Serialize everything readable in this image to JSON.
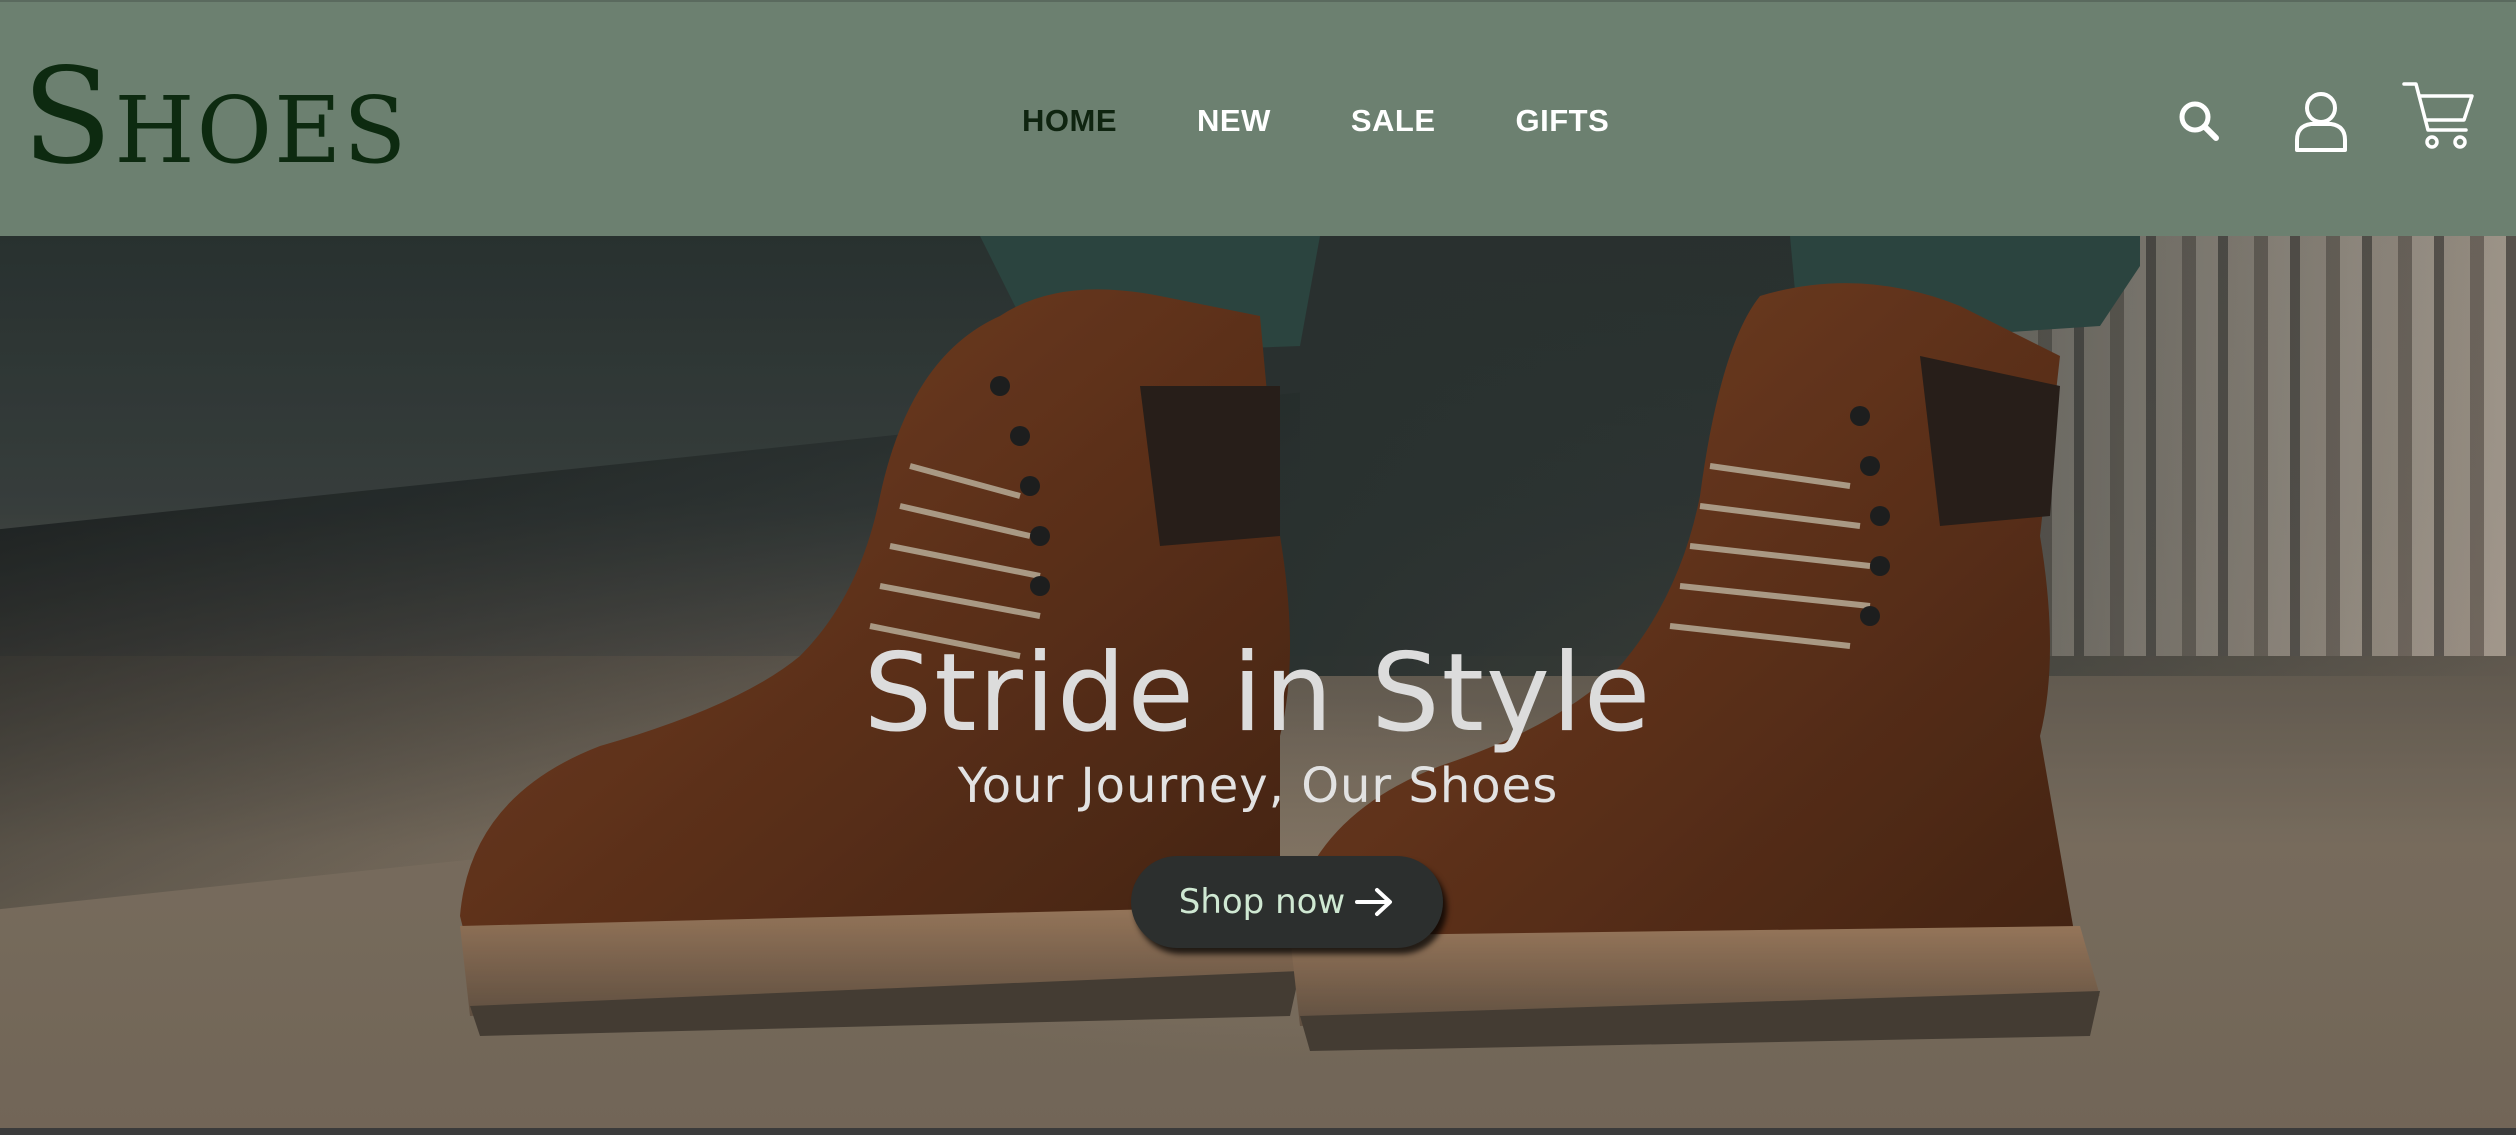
{
  "brand": {
    "name": "Shoes"
  },
  "nav": {
    "items": [
      {
        "label": "HOME",
        "active": true
      },
      {
        "label": "NEW",
        "active": false
      },
      {
        "label": "SALE",
        "active": false
      },
      {
        "label": "GIFTS",
        "active": false
      }
    ]
  },
  "header_icons": [
    "search-icon",
    "user-icon",
    "cart-icon"
  ],
  "hero": {
    "title": "Stride in Style",
    "subtitle": "Your Journey, Our Shoes",
    "cta_label": "Shop now",
    "cta_icon": "arrow-right-icon"
  },
  "colors": {
    "header_bg": "#6c8070",
    "brand_text": "#0d2a10",
    "nav_active": "#0f2410",
    "nav_text": "#ffffff",
    "cta_bg": "#2c2f2e",
    "cta_text": "#cfe8d2"
  }
}
